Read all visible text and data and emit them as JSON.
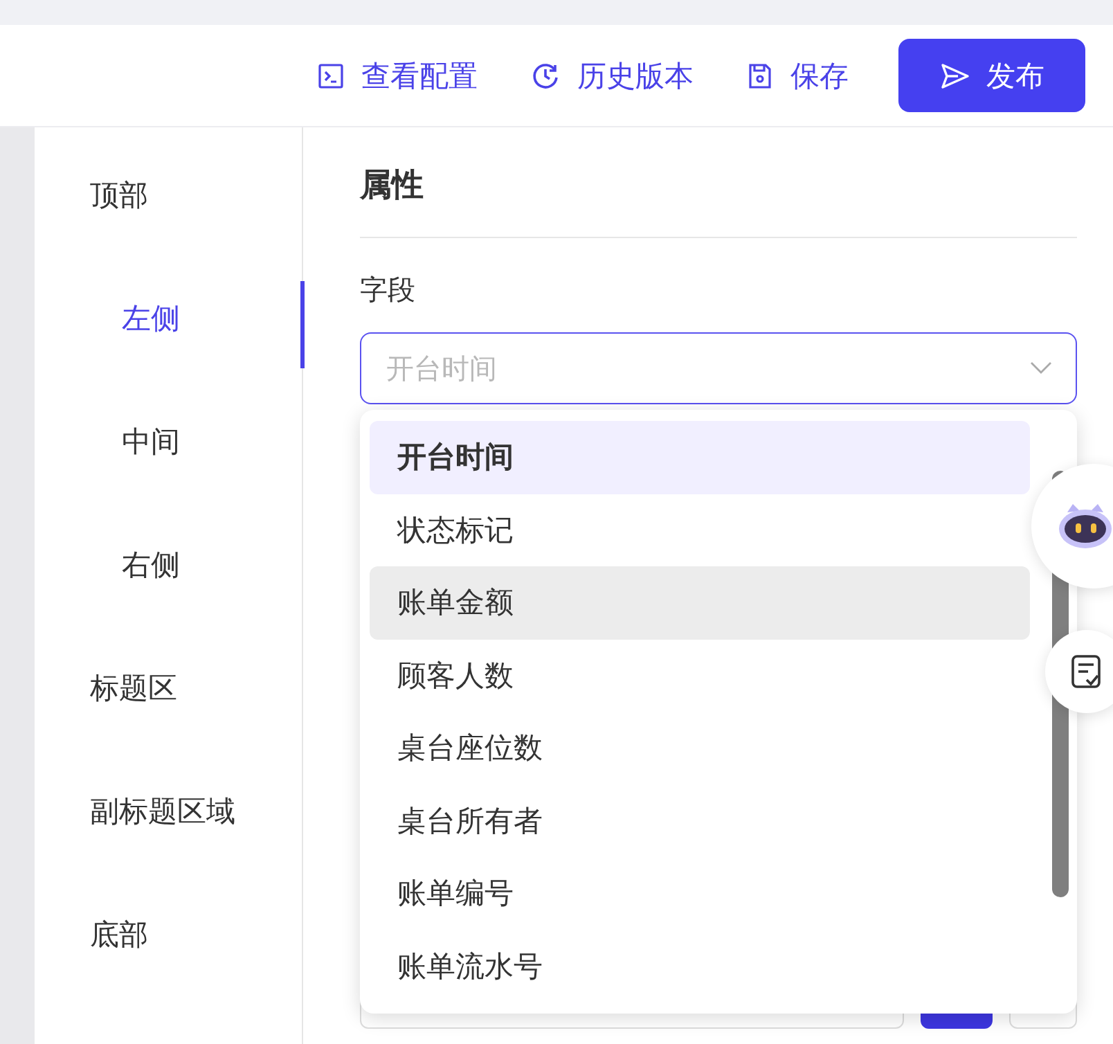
{
  "toolbar": {
    "actions": [
      {
        "kind": "config",
        "label": "查看配置"
      },
      {
        "kind": "history",
        "label": "历史版本"
      },
      {
        "kind": "save",
        "label": "保存"
      }
    ],
    "publish": {
      "label": "发布"
    }
  },
  "sidebar": {
    "items": [
      {
        "label": "顶部",
        "selected": false,
        "children": [
          {
            "label": "左侧",
            "selected": true
          },
          {
            "label": "中间",
            "selected": false
          },
          {
            "label": "右侧",
            "selected": false
          }
        ]
      },
      {
        "label": "标题区",
        "selected": false
      },
      {
        "label": "副标题区域",
        "selected": false
      },
      {
        "label": "底部",
        "selected": false
      }
    ]
  },
  "panel": {
    "title": "属性",
    "field": {
      "label": "字段",
      "placeholder": "开台时间",
      "expanded": true
    }
  },
  "dropdown": {
    "options": [
      {
        "label": "开台时间",
        "selected": true,
        "hovered": false
      },
      {
        "label": "状态标记",
        "selected": false,
        "hovered": false
      },
      {
        "label": "账单金额",
        "selected": false,
        "hovered": true
      },
      {
        "label": "顾客人数",
        "selected": false,
        "hovered": false
      },
      {
        "label": "桌台座位数",
        "selected": false,
        "hovered": false
      },
      {
        "label": "桌台所有者",
        "selected": false,
        "hovered": false
      },
      {
        "label": "账单编号",
        "selected": false,
        "hovered": false
      },
      {
        "label": "账单流水号",
        "selected": false,
        "hovered": false
      }
    ]
  },
  "floating": [
    {
      "kind": "assistant"
    },
    {
      "kind": "notes"
    }
  ]
}
